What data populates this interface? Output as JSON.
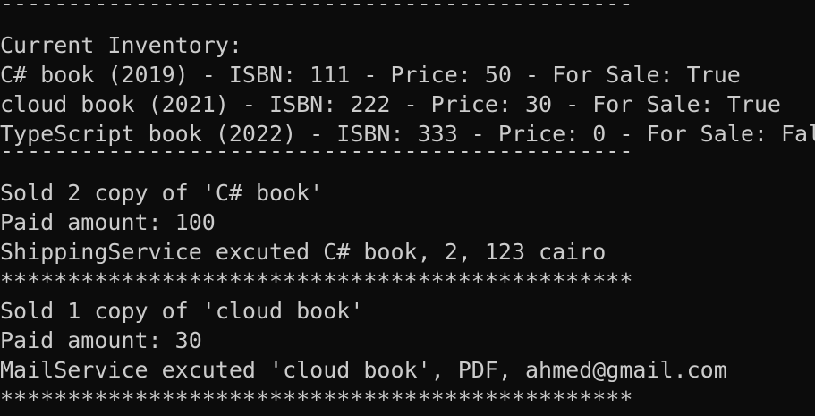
{
  "console": {
    "lines": [
      {
        "kind": "sep",
        "text": "-----------------------------------------------"
      },
      {
        "kind": "text",
        "text": "Current Inventory:"
      },
      {
        "kind": "text",
        "text": "C# book (2019) - ISBN: 111 - Price: 50 - For Sale: True"
      },
      {
        "kind": "text",
        "text": "cloud book (2021) - ISBN: 222 - Price: 30 - For Sale: True"
      },
      {
        "kind": "text",
        "text": "TypeScript book (2022) - ISBN: 333 - Price: 0 - For Sale: Fal"
      },
      {
        "kind": "sep",
        "text": "-----------------------------------------------"
      },
      {
        "kind": "text",
        "text": "Sold 2 copy of 'C# book'"
      },
      {
        "kind": "text",
        "text": "Paid amount: 100"
      },
      {
        "kind": "text",
        "text": "ShippingService excuted C# book, 2, 123 cairo"
      },
      {
        "kind": "stars",
        "text": "***********************************************"
      },
      {
        "kind": "text",
        "text": "Sold 1 copy of 'cloud book'"
      },
      {
        "kind": "text",
        "text": "Paid amount: 30"
      },
      {
        "kind": "text",
        "text": "MailService excuted 'cloud book', PDF, ahmed@gmail.com"
      },
      {
        "kind": "stars",
        "text": "***********************************************"
      }
    ]
  },
  "colors": {
    "background": "#0c0c0c",
    "foreground": "#cccccc"
  }
}
